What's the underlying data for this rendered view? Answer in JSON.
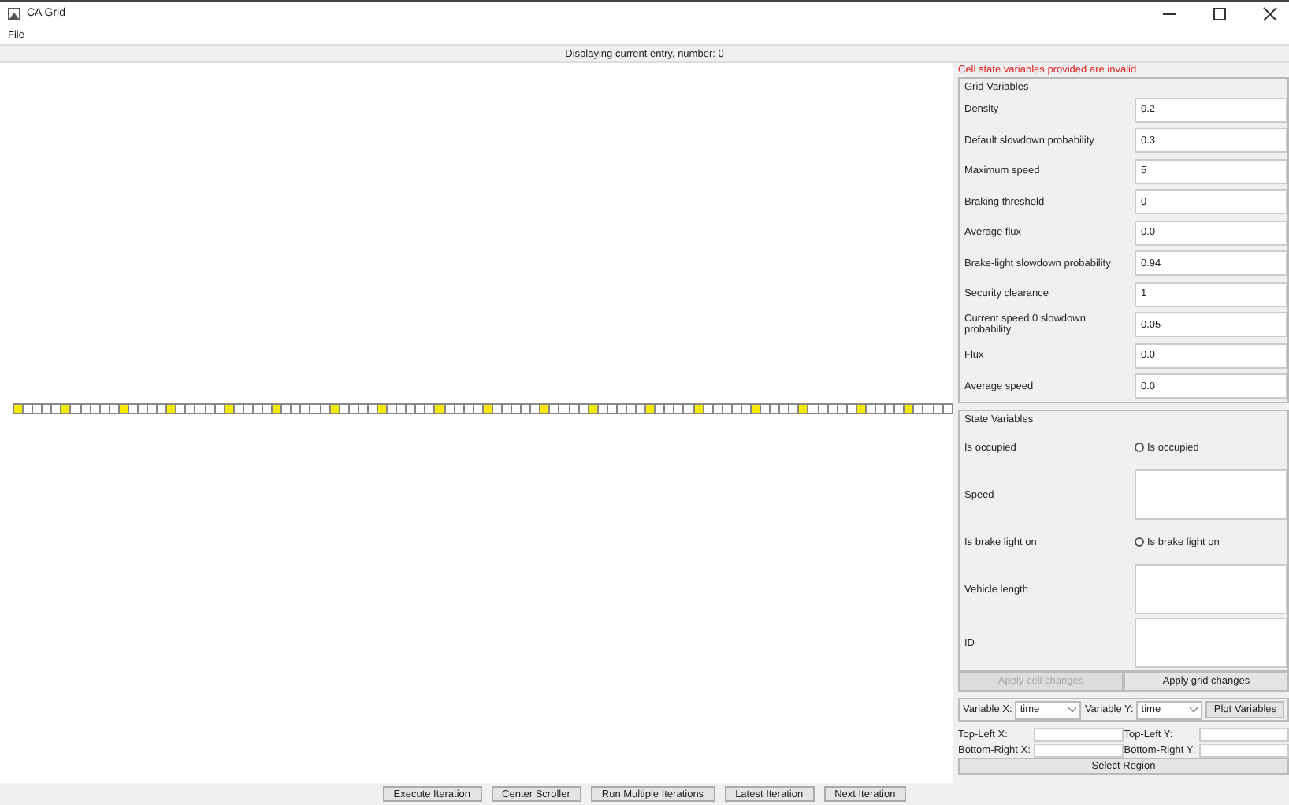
{
  "window": {
    "title": "CA Grid"
  },
  "menu": [
    "File"
  ],
  "status": "Displaying current entry, number: 0",
  "cells": [
    {
      "occupied": true
    },
    {
      "occupied": false
    },
    {
      "occupied": false
    },
    {
      "occupied": false
    },
    {
      "occupied": false
    },
    {
      "occupied": true
    },
    {
      "occupied": false
    },
    {
      "occupied": false
    },
    {
      "occupied": false
    },
    {
      "occupied": false
    },
    {
      "occupied": false
    },
    {
      "occupied": true
    },
    {
      "occupied": false
    },
    {
      "occupied": false
    },
    {
      "occupied": false
    },
    {
      "occupied": false
    },
    {
      "occupied": true
    },
    {
      "occupied": false
    },
    {
      "occupied": false
    },
    {
      "occupied": false
    },
    {
      "occupied": false
    },
    {
      "occupied": false
    },
    {
      "occupied": true
    },
    {
      "occupied": false
    },
    {
      "occupied": false
    },
    {
      "occupied": false
    },
    {
      "occupied": false
    },
    {
      "occupied": true
    },
    {
      "occupied": false
    },
    {
      "occupied": false
    },
    {
      "occupied": false
    },
    {
      "occupied": false
    },
    {
      "occupied": false
    },
    {
      "occupied": true
    },
    {
      "occupied": false
    },
    {
      "occupied": false
    },
    {
      "occupied": false
    },
    {
      "occupied": false
    },
    {
      "occupied": true
    },
    {
      "occupied": false
    },
    {
      "occupied": false
    },
    {
      "occupied": false
    },
    {
      "occupied": false
    },
    {
      "occupied": false
    },
    {
      "occupied": true
    },
    {
      "occupied": false
    },
    {
      "occupied": false
    },
    {
      "occupied": false
    },
    {
      "occupied": false
    },
    {
      "occupied": true
    },
    {
      "occupied": false
    },
    {
      "occupied": false
    },
    {
      "occupied": false
    },
    {
      "occupied": false
    },
    {
      "occupied": false
    },
    {
      "occupied": true
    },
    {
      "occupied": false
    },
    {
      "occupied": false
    },
    {
      "occupied": false
    },
    {
      "occupied": false
    },
    {
      "occupied": true
    },
    {
      "occupied": false
    },
    {
      "occupied": false
    },
    {
      "occupied": false
    },
    {
      "occupied": false
    },
    {
      "occupied": false
    },
    {
      "occupied": true
    },
    {
      "occupied": false
    },
    {
      "occupied": false
    },
    {
      "occupied": false
    },
    {
      "occupied": false
    },
    {
      "occupied": true
    },
    {
      "occupied": false
    },
    {
      "occupied": false
    },
    {
      "occupied": false
    },
    {
      "occupied": false
    },
    {
      "occupied": false
    },
    {
      "occupied": true
    },
    {
      "occupied": false
    },
    {
      "occupied": false
    },
    {
      "occupied": false
    },
    {
      "occupied": false
    },
    {
      "occupied": true
    },
    {
      "occupied": false
    },
    {
      "occupied": false
    },
    {
      "occupied": false
    },
    {
      "occupied": false
    },
    {
      "occupied": false
    },
    {
      "occupied": true
    },
    {
      "occupied": false
    },
    {
      "occupied": false
    },
    {
      "occupied": false
    },
    {
      "occupied": false
    },
    {
      "occupied": true
    },
    {
      "occupied": false
    },
    {
      "occupied": false
    },
    {
      "occupied": false
    },
    {
      "occupied": false
    }
  ],
  "error": "Cell state variables provided are invalid",
  "grid_variables": {
    "title": "Grid Variables",
    "fields": [
      {
        "label": "Density",
        "value": "0.2"
      },
      {
        "label": "Default slowdown probability",
        "value": "0.3"
      },
      {
        "label": "Maximum speed",
        "value": "5"
      },
      {
        "label": "Braking threshold",
        "value": "0"
      },
      {
        "label": "Average flux",
        "value": "0.0"
      },
      {
        "label": "Brake-light slowdown probability",
        "value": "0.94"
      },
      {
        "label": "Security clearance",
        "value": "1"
      },
      {
        "label": "Current speed 0 slowdown probability",
        "value": "0.05"
      },
      {
        "label": "Flux",
        "value": "0.0"
      },
      {
        "label": "Average speed",
        "value": "0.0"
      }
    ]
  },
  "state_variables": {
    "title": "State Variables",
    "items": [
      {
        "kind": "radio",
        "label": "Is occupied",
        "option": "Is occupied",
        "checked": false
      },
      {
        "kind": "text",
        "label": "Speed"
      },
      {
        "kind": "radio",
        "label": "Is brake light on",
        "option": "Is brake light on",
        "checked": false
      },
      {
        "kind": "text",
        "label": "Vehicle length"
      },
      {
        "kind": "text",
        "label": "ID"
      }
    ]
  },
  "apply_buttons": [
    {
      "label": "Apply cell changes",
      "disabled": true
    },
    {
      "label": "Apply grid changes",
      "disabled": false
    }
  ],
  "plot": {
    "variable_x": {
      "label": "Variable X:",
      "value": "time"
    },
    "variable_y": {
      "label": "Variable Y:",
      "value": "time"
    },
    "button": "Plot Variables"
  },
  "region": {
    "fields": [
      "Top-Left X:",
      "Top-Left Y:",
      "Bottom-Right X:",
      "Bottom-Right Y:"
    ],
    "button": "Select Region"
  },
  "bottom_buttons": [
    "Execute Iteration",
    "Center Scroller",
    "Run Multiple Iterations",
    "Latest Iteration",
    "Next Iteration"
  ]
}
